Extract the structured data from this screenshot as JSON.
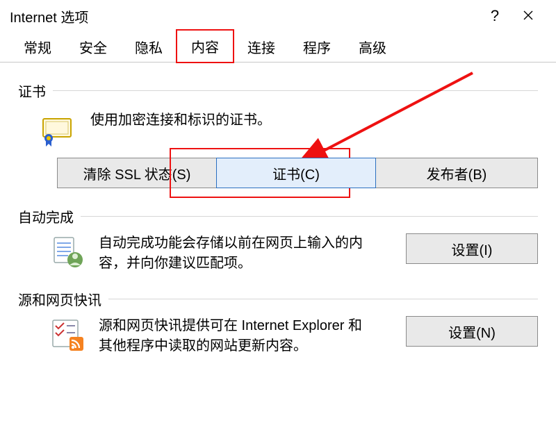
{
  "window": {
    "title": "Internet 选项",
    "help_glyph": "?",
    "close_label": "Close"
  },
  "tabs": [
    {
      "label": "常规"
    },
    {
      "label": "安全"
    },
    {
      "label": "隐私"
    },
    {
      "label": "内容"
    },
    {
      "label": "连接"
    },
    {
      "label": "程序"
    },
    {
      "label": "高级"
    }
  ],
  "active_tab_index": 3,
  "highlight_tab_index": 3,
  "certificates": {
    "heading": "证书",
    "desc": "使用加密连接和标识的证书。",
    "buttons": {
      "clear_ssl": "清除 SSL 状态(S)",
      "certificates": "证书(C)",
      "publishers": "发布者(B)"
    }
  },
  "autocomplete": {
    "heading": "自动完成",
    "desc": "自动完成功能会存储以前在网页上输入的内容，并向你建议匹配项。",
    "settings_btn": "设置(I)"
  },
  "feeds": {
    "heading": "源和网页快讯",
    "desc": "源和网页快讯提供可在 Internet Explorer 和其他程序中读取的网站更新内容。",
    "settings_btn": "设置(N)"
  },
  "annotation": {
    "hover_button_path": "certificates.buttons.certificates"
  }
}
